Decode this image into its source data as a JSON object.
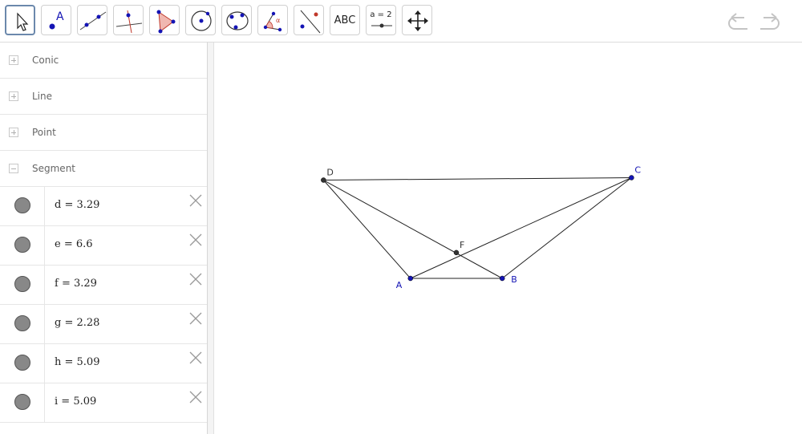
{
  "toolbar": {
    "tools": [
      {
        "name": "move-tool-button",
        "icon": "arrow-cursor-icon",
        "selected": true
      },
      {
        "name": "point-tool-button",
        "icon": "point-icon",
        "label": "A"
      },
      {
        "name": "line-tool-button",
        "icon": "line-through-points-icon"
      },
      {
        "name": "perpendicular-line-tool-button",
        "icon": "perpendicular-line-icon"
      },
      {
        "name": "polygon-tool-button",
        "icon": "polygon-icon"
      },
      {
        "name": "circle-center-point-tool-button",
        "icon": "circle-center-icon"
      },
      {
        "name": "circle-three-points-tool-button",
        "icon": "circle-three-points-icon"
      },
      {
        "name": "angle-tool-button",
        "icon": "angle-icon",
        "label": "α"
      },
      {
        "name": "reflect-tool-button",
        "icon": "reflect-about-line-icon"
      },
      {
        "name": "text-tool-button",
        "icon": "text-icon",
        "label": "ABC"
      },
      {
        "name": "slider-tool-button",
        "icon": "slider-icon",
        "label": "a = 2"
      },
      {
        "name": "move-graphics-view-tool-button",
        "icon": "move-arrows-icon"
      }
    ],
    "undo_icon": "undo-icon",
    "redo_icon": "redo-icon"
  },
  "algebra": {
    "groups": [
      {
        "label": "Conic",
        "expanded": false
      },
      {
        "label": "Line",
        "expanded": false
      },
      {
        "label": "Point",
        "expanded": false
      },
      {
        "label": "Segment",
        "expanded": true
      }
    ],
    "segments": [
      {
        "text": "d = 3.29"
      },
      {
        "text": "e = 6.6"
      },
      {
        "text": "f = 3.29"
      },
      {
        "text": "g = 2.28"
      },
      {
        "text": "h = 5.09"
      },
      {
        "text": "i = 5.09"
      }
    ]
  },
  "graphics": {
    "points": [
      {
        "label": "A",
        "x": -1.14,
        "y": 0,
        "color": "#1414b4"
      },
      {
        "label": "B",
        "x": 1.14,
        "y": 0,
        "color": "#1414b4"
      },
      {
        "label": "C",
        "x": 4.35,
        "y": 2.5,
        "color": "#1414b4"
      },
      {
        "label": "D",
        "x": -3.3,
        "y": 2.44,
        "color": "#333333"
      },
      {
        "label": "F",
        "x": 0,
        "y": 0.64,
        "color": "#333333"
      }
    ],
    "segments": [
      [
        "A",
        "B"
      ],
      [
        "B",
        "C"
      ],
      [
        "C",
        "D"
      ],
      [
        "D",
        "A"
      ],
      [
        "A",
        "C"
      ],
      [
        "D",
        "B"
      ]
    ],
    "segment_color": "#222222"
  },
  "colors": {
    "selected_border": "#6b88ac",
    "independent_point": "#1414b4",
    "dependent_point": "#333333",
    "marble": "#888888"
  }
}
